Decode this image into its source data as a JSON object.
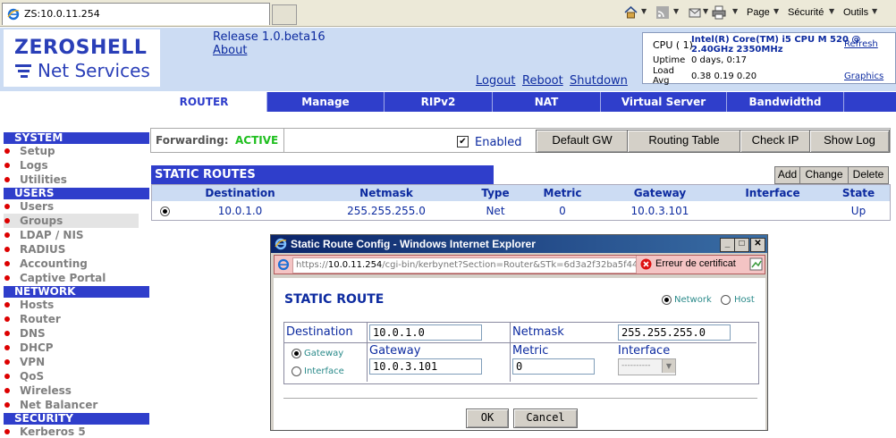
{
  "browser": {
    "tab_title": "ZS:10.0.11.254",
    "toolbar": {
      "page_label": "Page",
      "security_label": "Sécurité",
      "tools_label": "Outils"
    }
  },
  "header": {
    "logo_main": "ZEROSHELL",
    "logo_sub": "Net Services",
    "release": "Release 1.0.beta16",
    "about": "About",
    "logout": "Logout",
    "reboot": "Reboot",
    "shutdown": "Shutdown",
    "cpu": {
      "cpu_label": "CPU ( 1)",
      "cpu_model": "Intel(R) Core(TM) i5 CPU M 520 @",
      "cpu_speed": "2.40GHz 2350MHz",
      "refresh": "Refresh",
      "uptime_label": "Uptime",
      "uptime_value": "0 days, 0:17",
      "load_label": "Load",
      "load_label2": "Avg",
      "load_value": "0.38 0.19 0.20",
      "graphics": "Graphics"
    }
  },
  "nav": {
    "sections": [
      {
        "title": "SYSTEM",
        "items": [
          "Setup",
          "Logs",
          "Utilities"
        ]
      },
      {
        "title": "USERS",
        "items": [
          "Users",
          "Groups",
          "LDAP / NIS",
          "RADIUS",
          "Accounting",
          "Captive Portal"
        ]
      },
      {
        "title": "NETWORK",
        "items": [
          "Hosts",
          "Router",
          "DNS",
          "DHCP",
          "VPN",
          "QoS",
          "Wireless",
          "Net Balancer"
        ]
      },
      {
        "title": "SECURITY",
        "items": [
          "Kerberos 5"
        ]
      }
    ]
  },
  "tabs": [
    "ROUTER",
    "Manage",
    "RIPv2",
    "NAT",
    "Virtual Server",
    "Bandwidthd"
  ],
  "forwarding": {
    "label": "Forwarding:",
    "status": "ACTIVE",
    "enabled_label": "Enabled",
    "buttons": [
      "Default GW",
      "Routing Table",
      "Check IP",
      "Show Log"
    ]
  },
  "static_routes": {
    "title": "STATIC ROUTES",
    "actions": [
      "Add",
      "Change",
      "Delete"
    ],
    "columns": [
      "Destination",
      "Netmask",
      "Type",
      "Metric",
      "Gateway",
      "Interface",
      "State"
    ],
    "rows": [
      {
        "destination": "10.0.1.0",
        "netmask": "255.255.255.0",
        "type": "Net",
        "metric": "0",
        "gateway": "10.0.3.101",
        "interface": "",
        "state": "Up"
      }
    ]
  },
  "popup": {
    "title": "Static Route Config - Windows Internet Explorer",
    "url_prefix": "https://",
    "url_host": "10.0.11.254",
    "url_path": "/cgi-bin/kerbynet?Section=Router&STk=6d3a2f32ba5f44(",
    "cert_error": "Erreur de certificat",
    "heading": "STATIC ROUTE",
    "opt_network": "Network",
    "opt_host": "Host",
    "destination_label": "Destination",
    "destination_value": "10.0.1.0",
    "netmask_label": "Netmask",
    "netmask_value": "255.255.255.0",
    "radio_gateway": "Gateway",
    "radio_interface": "Interface",
    "gateway_label": "Gateway",
    "gateway_value": "10.0.3.101",
    "metric_label": "Metric",
    "metric_value": "0",
    "interface_label": "Interface",
    "interface_value": "----------",
    "ok": "OK",
    "cancel": "Cancel"
  }
}
